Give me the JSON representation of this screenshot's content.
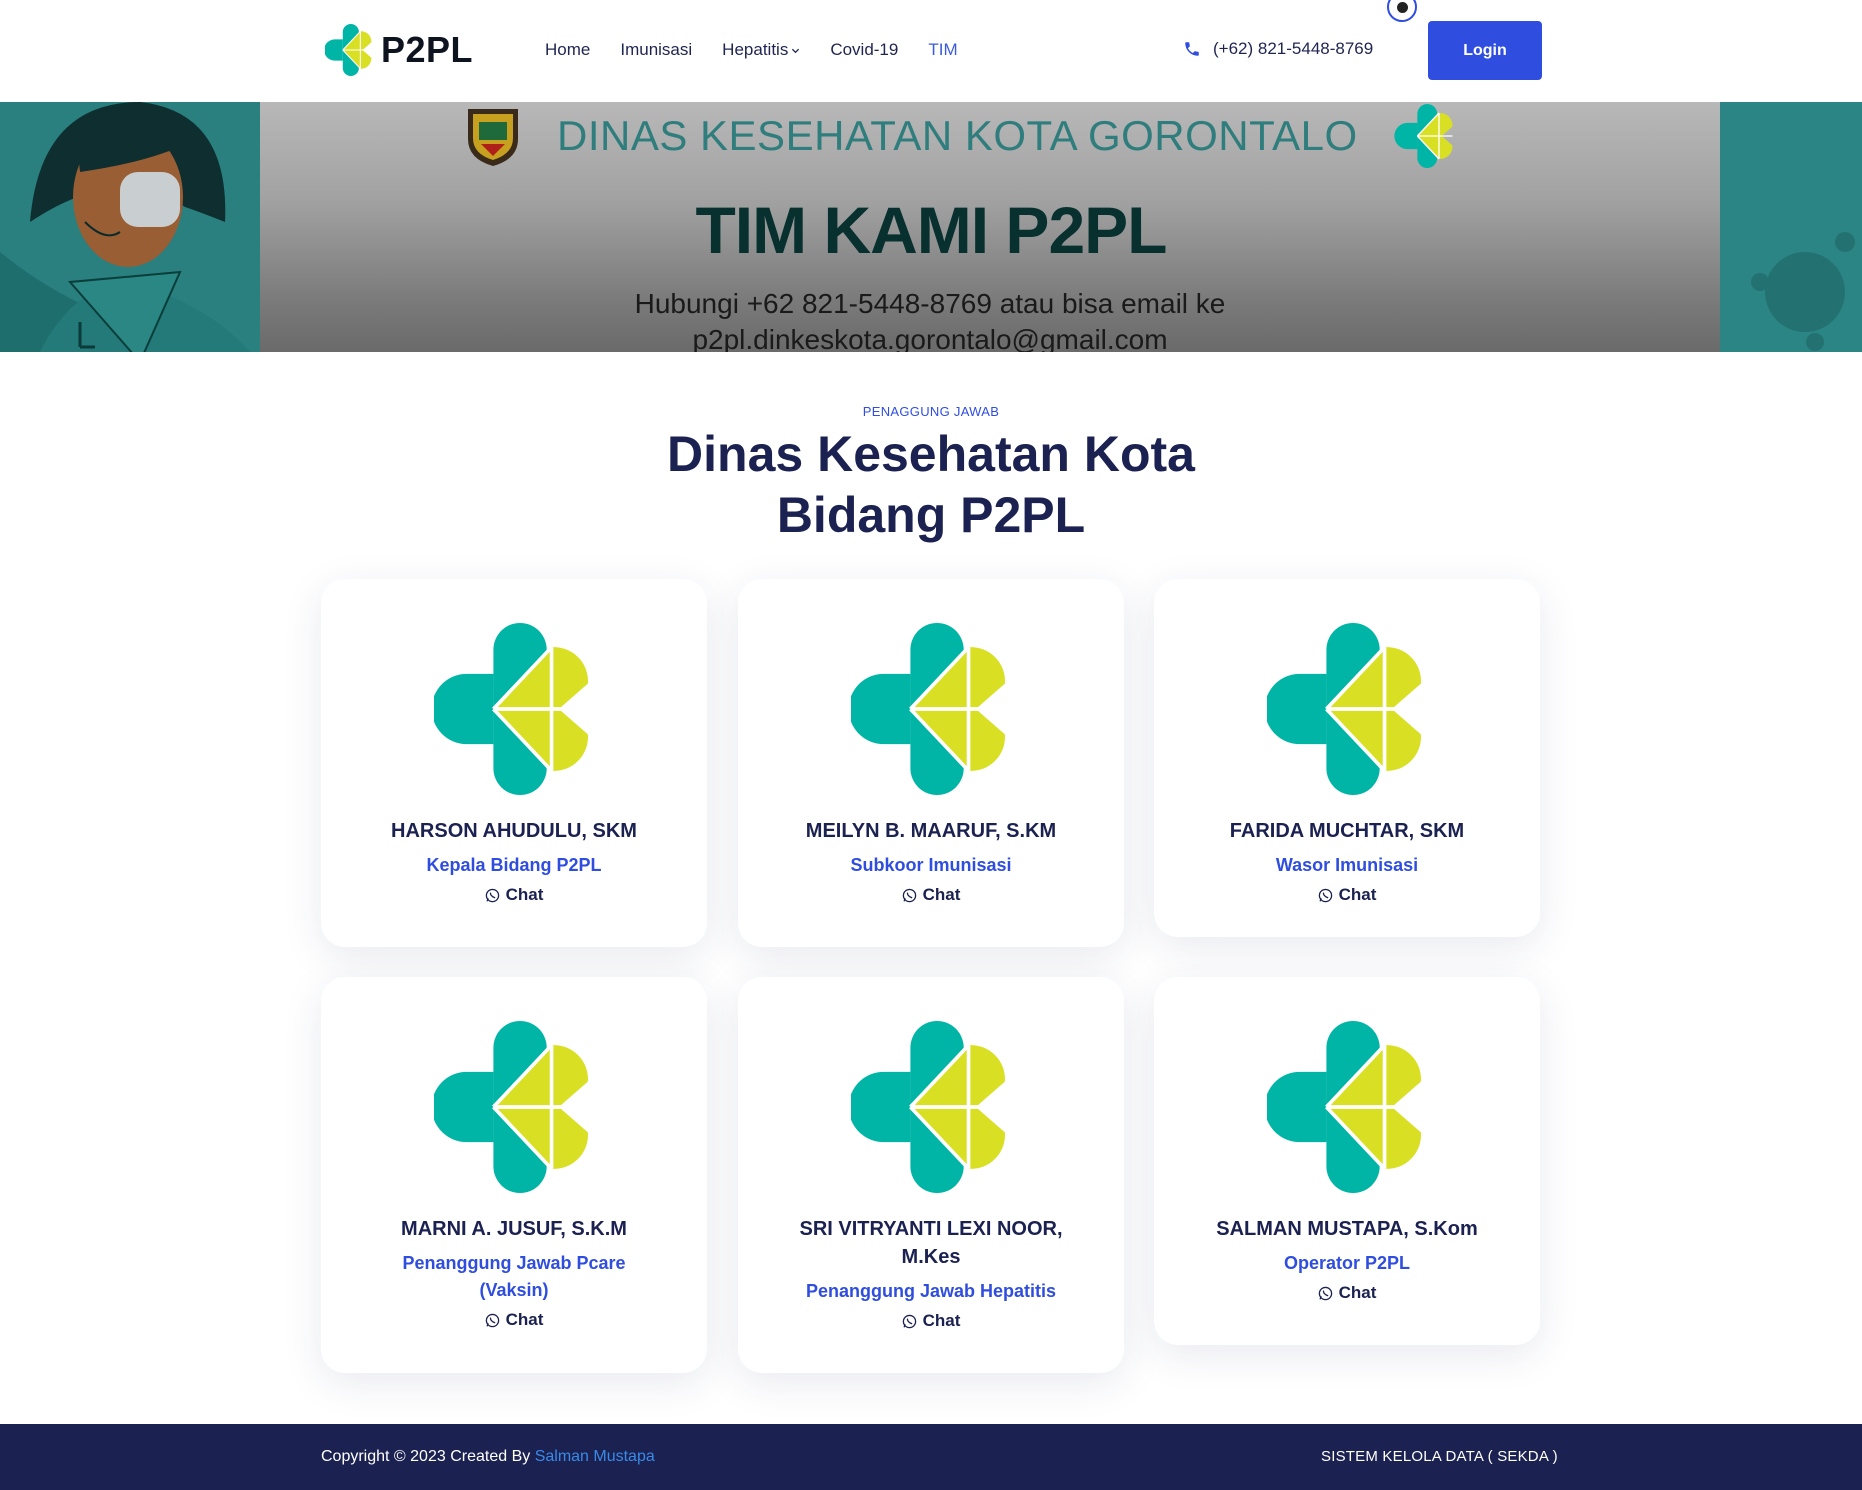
{
  "brand": {
    "name": "P2PL",
    "logo_icon": "kemenkes-logo-icon"
  },
  "nav": {
    "items": [
      {
        "label": "Home",
        "active": false
      },
      {
        "label": "Imunisasi",
        "active": false
      },
      {
        "label": "Hepatitis",
        "active": false,
        "has_dropdown": true
      },
      {
        "label": "Covid-19",
        "active": false
      },
      {
        "label": "TIM",
        "active": true
      }
    ]
  },
  "contact": {
    "phone": "(+62) 821-5448-8769",
    "icon": "phone-icon"
  },
  "login": {
    "label": "Login"
  },
  "banner": {
    "org_name": "DINAS KESEHATAN KOTA GORONTALO",
    "title": "TIM KAMI P2PL",
    "subtitle_line1": "Hubungi +62 821-5448-8769 atau bisa email ke",
    "subtitle_line2": "p2pl.dinkeskota.gorontalo@gmail.com"
  },
  "section": {
    "eyebrow": "PENAGGUNG JAWAB",
    "title_line1": "Dinas Kesehatan Kota",
    "title_line2": "Bidang P2PL"
  },
  "team": [
    {
      "name": "HARSON AHUDULU, SKM",
      "role": "Kepala Bidang P2PL",
      "chat": "Chat"
    },
    {
      "name": "MEILYN B. MAARUF, S.KM",
      "role": "Subkoor Imunisasi",
      "chat": "Chat"
    },
    {
      "name": "FARIDA MUCHTAR, SKM",
      "role": "Wasor Imunisasi",
      "chat": "Chat"
    },
    {
      "name": "MARNI A. JUSUF, S.K.M",
      "role": "Penanggung Jawab Pcare (Vaksin)",
      "chat": "Chat"
    },
    {
      "name": "SRI VITRYANTI LEXI NOOR, M.Kes",
      "role": "Penanggung Jawab Hepatitis",
      "chat": "Chat"
    },
    {
      "name": "SALMAN MUSTAPA, S.Kom",
      "role": "Operator P2PL",
      "chat": "Chat"
    }
  ],
  "footer": {
    "copyright": "Copyright © 2023 Created By ",
    "author": "Salman Mustapa",
    "right_text": "SISTEM KELOLA DATA ( SEKDA )"
  },
  "colors": {
    "primary": "#2f4ee0",
    "navy": "#1b2150",
    "logo_teal": "#00b5a5",
    "logo_lime": "#d9e024"
  }
}
